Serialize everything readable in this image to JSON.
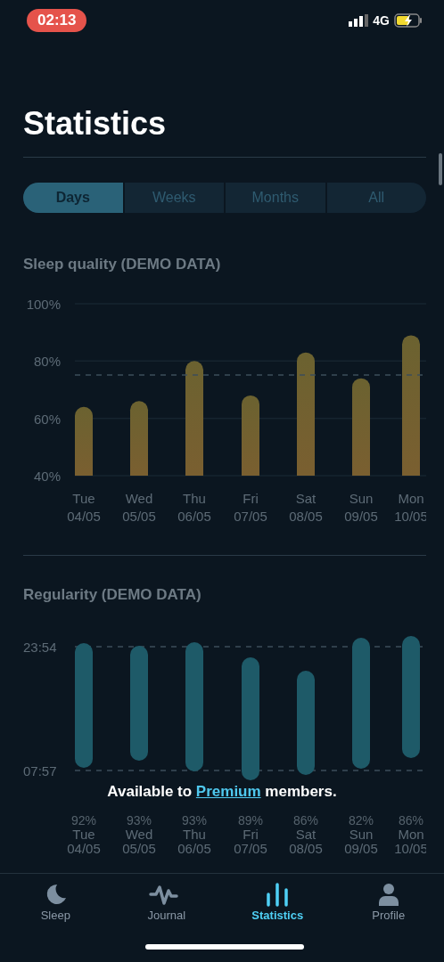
{
  "status_bar": {
    "time": "02:13",
    "network": "4G"
  },
  "title": "Statistics",
  "tabs": [
    {
      "label": "Days",
      "selected": true
    },
    {
      "label": "Weeks",
      "selected": false
    },
    {
      "label": "Months",
      "selected": false
    },
    {
      "label": "All",
      "selected": false
    }
  ],
  "sleep_quality": {
    "title": "Sleep quality  (DEMO DATA)",
    "dates": [
      "04/05",
      "05/05",
      "06/05",
      "07/05",
      "08/05",
      "09/05",
      "10/05"
    ],
    "chart_data": {
      "type": "bar",
      "categories": [
        "Tue",
        "Wed",
        "Thu",
        "Fri",
        "Sat",
        "Sun",
        "Mon"
      ],
      "series": [
        {
          "color": "#7a5f30",
          "values": [
            64,
            66,
            80,
            68,
            83,
            74,
            89
          ]
        }
      ],
      "ylim": [
        40,
        100
      ],
      "yticks": [
        {
          "value": 40,
          "label": "40%"
        },
        {
          "value": 60,
          "label": "60%"
        },
        {
          "value": 80,
          "label": "80%"
        },
        {
          "value": 100,
          "label": "100%"
        }
      ]
    }
  },
  "regularity": {
    "title": "Regularity  (DEMO DATA)",
    "y_labels": [
      "23:54",
      "07:57"
    ],
    "days": [
      {
        "day": "Tue",
        "date": "04/05",
        "score": "92%"
      },
      {
        "day": "Wed",
        "date": "05/05",
        "score": "93%"
      },
      {
        "day": "Thu",
        "date": "06/05",
        "score": "93%"
      },
      {
        "day": "Fri",
        "date": "07/05",
        "score": "89%"
      },
      {
        "day": "Sat",
        "date": "08/05",
        "score": "86%"
      },
      {
        "day": "Sun",
        "date": "09/05",
        "score": "82%"
      },
      {
        "day": "Mon",
        "date": "10/05",
        "score": "86%"
      }
    ]
  },
  "premium_notice": {
    "before": "Available to ",
    "link": "Premium",
    "after": " members."
  },
  "nav": [
    {
      "label": "Sleep",
      "kind": "moon",
      "selected": false
    },
    {
      "label": "Journal",
      "kind": "wave",
      "selected": false
    },
    {
      "label": "Statistics",
      "kind": "bars",
      "selected": true
    },
    {
      "label": "Profile",
      "kind": "person",
      "selected": false
    }
  ]
}
